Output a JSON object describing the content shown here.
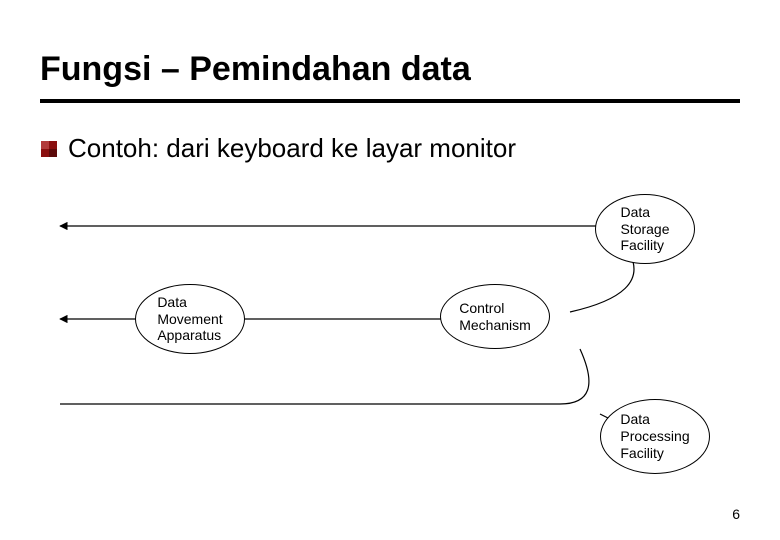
{
  "title": "Fungsi – Pemindahan data",
  "bullet": {
    "icon": "bullet-square-icon",
    "text": "Contoh: dari keyboard ke layar monitor"
  },
  "nodes": {
    "storage": "Data\nStorage\nFacility",
    "movement": "Data\nMovement\nApparatus",
    "control": "Control\nMechanism",
    "processing": "Data\nProcessing\nFacility"
  },
  "page_number": "6",
  "colors": {
    "bullet_fill": "#8a0f0f"
  }
}
